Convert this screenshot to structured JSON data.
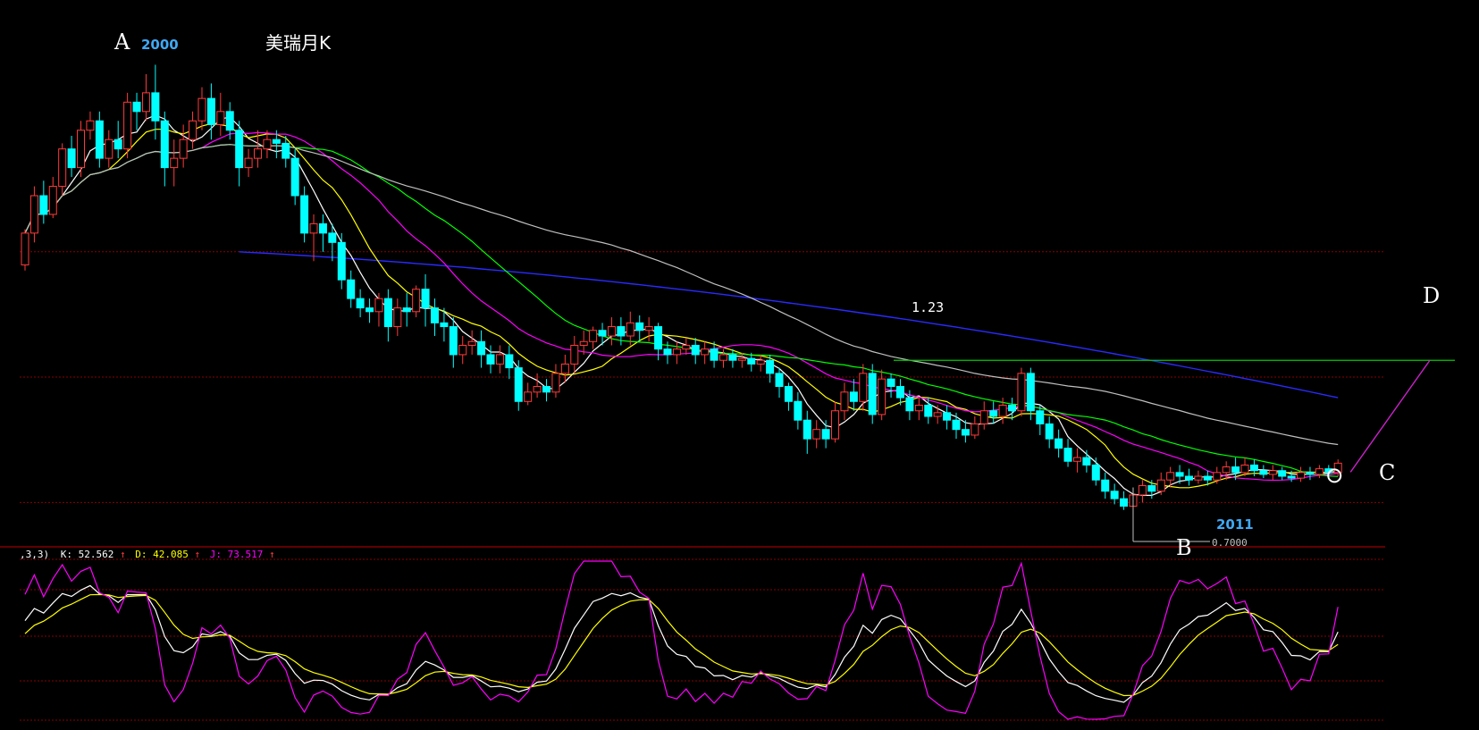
{
  "chart_data": {
    "type": "candlestick",
    "title": "美瑞月K",
    "price_panel": {
      "ylim": [
        0.58,
        3.15
      ],
      "grid_prices": [
        2.1,
        1.43,
        0.76
      ],
      "candles": [
        [
          2.03,
          2.2,
          2.0,
          2.22
        ],
        [
          2.2,
          2.4,
          2.15,
          2.45
        ],
        [
          2.4,
          2.3,
          2.25,
          2.48
        ],
        [
          2.3,
          2.45,
          2.28,
          2.5
        ],
        [
          2.45,
          2.65,
          2.4,
          2.68
        ],
        [
          2.65,
          2.55,
          2.5,
          2.72
        ],
        [
          2.55,
          2.75,
          2.5,
          2.8
        ],
        [
          2.75,
          2.8,
          2.7,
          2.85
        ],
        [
          2.8,
          2.6,
          2.55,
          2.85
        ],
        [
          2.6,
          2.7,
          2.55,
          2.75
        ],
        [
          2.7,
          2.65,
          2.6,
          2.8
        ],
        [
          2.65,
          2.9,
          2.6,
          2.95
        ],
        [
          2.9,
          2.85,
          2.75,
          2.95
        ],
        [
          2.85,
          2.95,
          2.8,
          3.05
        ],
        [
          2.95,
          2.8,
          2.7,
          3.1
        ],
        [
          2.8,
          2.55,
          2.45,
          2.85
        ],
        [
          2.55,
          2.6,
          2.45,
          2.7
        ],
        [
          2.6,
          2.7,
          2.55,
          2.78
        ],
        [
          2.7,
          2.8,
          2.65,
          2.85
        ],
        [
          2.8,
          2.92,
          2.75,
          2.98
        ],
        [
          2.92,
          2.78,
          2.7,
          3.0
        ],
        [
          2.78,
          2.85,
          2.72,
          2.95
        ],
        [
          2.85,
          2.75,
          2.7,
          2.9
        ],
        [
          2.75,
          2.55,
          2.45,
          2.8
        ],
        [
          2.55,
          2.6,
          2.5,
          2.65
        ],
        [
          2.6,
          2.65,
          2.55,
          2.75
        ],
        [
          2.65,
          2.7,
          2.6,
          2.75
        ],
        [
          2.7,
          2.68,
          2.6,
          2.75
        ],
        [
          2.68,
          2.6,
          2.55,
          2.72
        ],
        [
          2.6,
          2.4,
          2.35,
          2.65
        ],
        [
          2.4,
          2.2,
          2.15,
          2.45
        ],
        [
          2.2,
          2.25,
          2.05,
          2.3
        ],
        [
          2.25,
          2.2,
          2.1,
          2.3
        ],
        [
          2.2,
          2.15,
          2.05,
          2.25
        ],
        [
          2.15,
          1.95,
          1.9,
          2.2
        ],
        [
          1.95,
          1.85,
          1.8,
          2.0
        ],
        [
          1.85,
          1.8,
          1.75,
          1.9
        ],
        [
          1.8,
          1.78,
          1.72,
          1.85
        ],
        [
          1.78,
          1.85,
          1.7,
          1.88
        ],
        [
          1.85,
          1.7,
          1.62,
          1.9
        ],
        [
          1.7,
          1.8,
          1.65,
          1.85
        ],
        [
          1.8,
          1.78,
          1.7,
          1.88
        ],
        [
          1.78,
          1.9,
          1.75,
          1.92
        ],
        [
          1.9,
          1.8,
          1.7,
          1.98
        ],
        [
          1.8,
          1.72,
          1.65,
          1.85
        ],
        [
          1.72,
          1.7,
          1.62,
          1.8
        ],
        [
          1.7,
          1.55,
          1.48,
          1.75
        ],
        [
          1.55,
          1.6,
          1.5,
          1.65
        ],
        [
          1.6,
          1.62,
          1.55,
          1.68
        ],
        [
          1.62,
          1.55,
          1.48,
          1.68
        ],
        [
          1.55,
          1.5,
          1.45,
          1.6
        ],
        [
          1.5,
          1.55,
          1.45,
          1.6
        ],
        [
          1.55,
          1.48,
          1.42,
          1.6
        ],
        [
          1.48,
          1.3,
          1.25,
          1.52
        ],
        [
          1.3,
          1.35,
          1.28,
          1.4
        ],
        [
          1.35,
          1.38,
          1.32,
          1.45
        ],
        [
          1.38,
          1.35,
          1.3,
          1.42
        ],
        [
          1.35,
          1.45,
          1.32,
          1.5
        ],
        [
          1.45,
          1.5,
          1.4,
          1.55
        ],
        [
          1.5,
          1.6,
          1.45,
          1.65
        ],
        [
          1.6,
          1.62,
          1.55,
          1.68
        ],
        [
          1.62,
          1.68,
          1.58,
          1.7
        ],
        [
          1.68,
          1.65,
          1.6,
          1.72
        ],
        [
          1.65,
          1.7,
          1.6,
          1.75
        ],
        [
          1.7,
          1.65,
          1.6,
          1.75
        ],
        [
          1.65,
          1.72,
          1.6,
          1.78
        ],
        [
          1.72,
          1.68,
          1.62,
          1.76
        ],
        [
          1.68,
          1.7,
          1.62,
          1.75
        ],
        [
          1.7,
          1.58,
          1.52,
          1.72
        ],
        [
          1.58,
          1.55,
          1.5,
          1.62
        ],
        [
          1.55,
          1.58,
          1.5,
          1.62
        ],
        [
          1.58,
          1.6,
          1.55,
          1.64
        ],
        [
          1.6,
          1.55,
          1.5,
          1.64
        ],
        [
          1.55,
          1.58,
          1.5,
          1.62
        ],
        [
          1.58,
          1.52,
          1.48,
          1.62
        ],
        [
          1.52,
          1.55,
          1.48,
          1.58
        ],
        [
          1.55,
          1.52,
          1.48,
          1.58
        ],
        [
          1.52,
          1.53,
          1.48,
          1.56
        ],
        [
          1.53,
          1.5,
          1.46,
          1.56
        ],
        [
          1.5,
          1.52,
          1.46,
          1.55
        ],
        [
          1.52,
          1.45,
          1.4,
          1.55
        ],
        [
          1.45,
          1.38,
          1.32,
          1.48
        ],
        [
          1.38,
          1.3,
          1.25,
          1.4
        ],
        [
          1.3,
          1.2,
          1.15,
          1.35
        ],
        [
          1.2,
          1.1,
          1.02,
          1.25
        ],
        [
          1.1,
          1.15,
          1.05,
          1.2
        ],
        [
          1.15,
          1.1,
          1.05,
          1.2
        ],
        [
          1.1,
          1.25,
          1.08,
          1.3
        ],
        [
          1.25,
          1.35,
          1.2,
          1.4
        ],
        [
          1.35,
          1.3,
          1.25,
          1.42
        ],
        [
          1.3,
          1.45,
          1.25,
          1.5
        ],
        [
          1.45,
          1.23,
          1.18,
          1.5
        ],
        [
          1.23,
          1.42,
          1.2,
          1.47
        ],
        [
          1.42,
          1.38,
          1.32,
          1.45
        ],
        [
          1.38,
          1.32,
          1.28,
          1.42
        ],
        [
          1.32,
          1.25,
          1.2,
          1.36
        ],
        [
          1.25,
          1.28,
          1.2,
          1.32
        ],
        [
          1.28,
          1.22,
          1.18,
          1.32
        ],
        [
          1.22,
          1.24,
          1.18,
          1.28
        ],
        [
          1.24,
          1.2,
          1.15,
          1.28
        ],
        [
          1.2,
          1.15,
          1.1,
          1.24
        ],
        [
          1.15,
          1.12,
          1.08,
          1.2
        ],
        [
          1.12,
          1.18,
          1.1,
          1.22
        ],
        [
          1.18,
          1.25,
          1.15,
          1.3
        ],
        [
          1.25,
          1.22,
          1.18,
          1.3
        ],
        [
          1.22,
          1.28,
          1.18,
          1.32
        ],
        [
          1.28,
          1.25,
          1.2,
          1.32
        ],
        [
          1.25,
          1.45,
          1.22,
          1.48
        ],
        [
          1.45,
          1.25,
          1.2,
          1.48
        ],
        [
          1.25,
          1.18,
          1.12,
          1.28
        ],
        [
          1.18,
          1.1,
          1.05,
          1.22
        ],
        [
          1.1,
          1.05,
          1.0,
          1.15
        ],
        [
          1.05,
          0.98,
          0.95,
          1.1
        ],
        [
          0.98,
          1.0,
          0.92,
          1.05
        ],
        [
          1.0,
          0.96,
          0.92,
          1.04
        ],
        [
          0.96,
          0.88,
          0.85,
          1.0
        ],
        [
          0.88,
          0.82,
          0.78,
          0.92
        ],
        [
          0.82,
          0.78,
          0.75,
          0.86
        ],
        [
          0.78,
          0.74,
          0.72,
          0.82
        ],
        [
          0.74,
          0.8,
          0.7,
          0.84
        ],
        [
          0.8,
          0.85,
          0.76,
          0.88
        ],
        [
          0.85,
          0.82,
          0.78,
          0.88
        ],
        [
          0.82,
          0.88,
          0.8,
          0.92
        ],
        [
          0.88,
          0.92,
          0.84,
          0.95
        ],
        [
          0.92,
          0.9,
          0.86,
          0.96
        ],
        [
          0.9,
          0.88,
          0.85,
          0.94
        ],
        [
          0.88,
          0.9,
          0.86,
          0.93
        ],
        [
          0.9,
          0.88,
          0.85,
          0.93
        ],
        [
          0.88,
          0.92,
          0.86,
          0.95
        ],
        [
          0.92,
          0.95,
          0.88,
          0.98
        ],
        [
          0.95,
          0.92,
          0.88,
          1.0
        ],
        [
          0.92,
          0.96,
          0.9,
          1.0
        ],
        [
          0.96,
          0.93,
          0.9,
          0.99
        ],
        [
          0.93,
          0.91,
          0.89,
          0.96
        ],
        [
          0.91,
          0.93,
          0.88,
          0.96
        ],
        [
          0.93,
          0.9,
          0.88,
          0.95
        ],
        [
          0.9,
          0.89,
          0.87,
          0.93
        ],
        [
          0.89,
          0.92,
          0.87,
          0.95
        ],
        [
          0.92,
          0.91,
          0.88,
          0.95
        ],
        [
          0.91,
          0.94,
          0.89,
          0.96
        ],
        [
          0.94,
          0.92,
          0.89,
          0.96
        ],
        [
          0.92,
          0.97,
          0.9,
          0.99
        ]
      ],
      "ma_colors": [
        "#ffffff",
        "#ffff00",
        "#ff00ff",
        "#00ff00",
        "#c0c0c0"
      ],
      "ma_periods": [
        5,
        10,
        20,
        30,
        60
      ],
      "long_ma": {
        "color": "#2a2aff",
        "start_index": 23,
        "values_start": 2.1,
        "values_end": 1.32
      }
    },
    "annotations": {
      "A": "A",
      "B": "B",
      "C": "C",
      "D": "D",
      "year_2000": "2000",
      "year_2011": "2011",
      "level_label": "1.23",
      "level_price": 1.52,
      "low_label": "0.7000",
      "projection_to": 1.52
    },
    "kdj_panel": {
      "header_params": ",3,3)",
      "k_text": "K: 52.562",
      "d_text": "D: 42.085",
      "j_text": "J: 73.517",
      "arrow": "↑",
      "colors": {
        "K": "#ffffff",
        "D": "#ffff00",
        "J": "#ff00ff"
      },
      "ylim": [
        -5,
        105
      ]
    },
    "colors": {
      "up": "#ff3b3b",
      "down": "#00ffff",
      "grid": "#8b0000",
      "level_line": "#00cc00",
      "projection": "#cc22cc"
    }
  }
}
